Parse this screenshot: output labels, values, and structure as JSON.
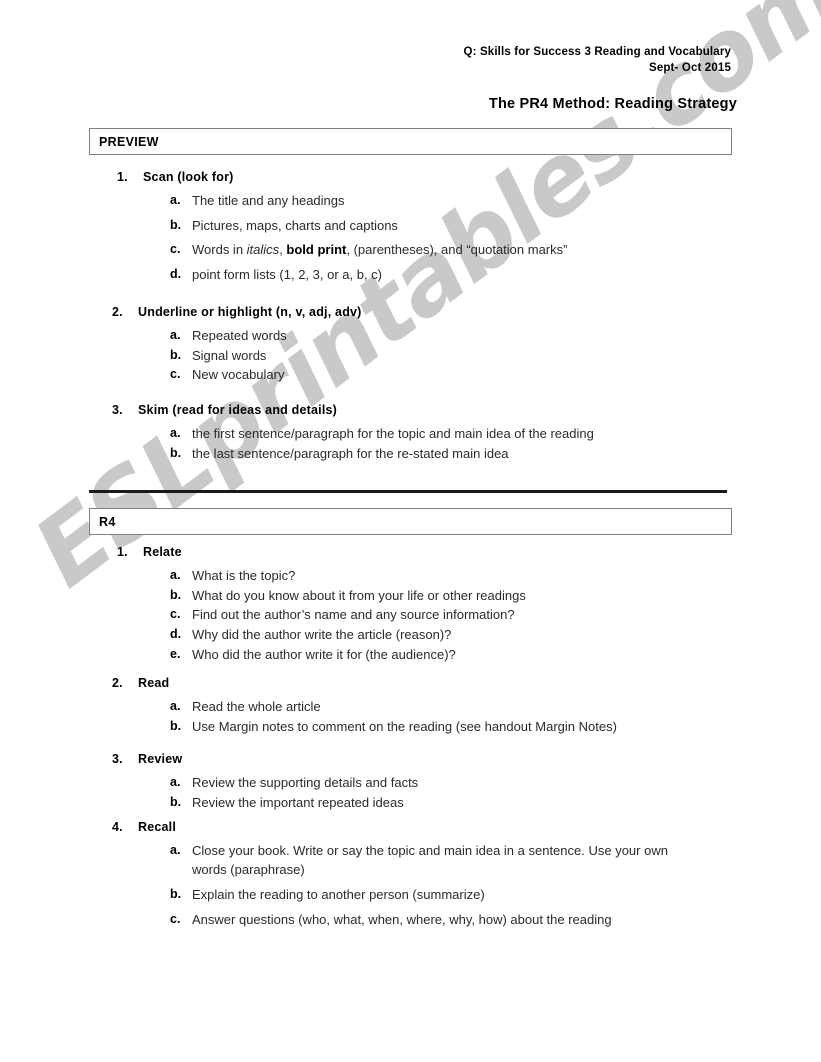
{
  "header": {
    "course": "Q: Skills for Success 3 Reading and Vocabulary",
    "date": "Sept- Oct 2015",
    "title": "The PR4 Method:  Reading Strategy"
  },
  "sections": [
    {
      "bar_label": "PREVIEW",
      "items": [
        {
          "number": "1.",
          "title": "Scan (look for)",
          "sub_items": [
            {
              "letter": "a.",
              "text": "The title and any headings"
            },
            {
              "letter": "b.",
              "text": "Pictures, maps, charts and captions"
            },
            {
              "letter": "c.",
              "text": "Words in italics, bold print, (parentheses), and “quotation marks”"
            },
            {
              "letter": "d.",
              "text": "point form lists (1, 2, 3, or a, b, c)"
            }
          ]
        },
        {
          "number": "2.",
          "title": "Underline or highlight (n, v, adj, adv)",
          "sub_items": [
            {
              "letter": "a.",
              "text": "Repeated words"
            },
            {
              "letter": "b.",
              "text": "Signal words"
            },
            {
              "letter": "c.",
              "text": "New vocabulary"
            }
          ]
        },
        {
          "number": "3.",
          "title": "Skim (read for ideas and details)",
          "sub_items": [
            {
              "letter": "a.",
              "text": "the first sentence/paragraph for the topic and main idea of the reading"
            },
            {
              "letter": "b.",
              "text": "the last sentence/paragraph for the re-stated main idea"
            }
          ]
        }
      ]
    },
    {
      "bar_label": "R4",
      "items": [
        {
          "number": "1.",
          "title": "Relate",
          "sub_items": [
            {
              "letter": "a.",
              "text": "What is the topic?"
            },
            {
              "letter": "b.",
              "text": "What do you know about it from your life or other readings"
            },
            {
              "letter": "c.",
              "text": "Find out the author’s name and any source information?"
            },
            {
              "letter": "d.",
              "text": "Why did the author write the article (reason)?"
            },
            {
              "letter": "e.",
              "text": "Who did the author write it for (the audience)?"
            }
          ]
        },
        {
          "number": "2.",
          "title": "Read",
          "sub_items": [
            {
              "letter": "a.",
              "text": "Read the whole article"
            },
            {
              "letter": "b.",
              "text": "Use Margin notes to comment on the reading (see handout Margin Notes)"
            }
          ]
        },
        {
          "number": "3.",
          "title": "Review",
          "sub_items": [
            {
              "letter": "a.",
              "text": "Review the supporting details and facts"
            },
            {
              "letter": "b.",
              "text": "Review the important repeated ideas"
            }
          ]
        },
        {
          "number": "4.",
          "title": "Recall",
          "sub_items": [
            {
              "letter": "a.",
              "text": "Close your book. Write or say the topic and main idea in a sentence. Use your own words (paraphrase)"
            },
            {
              "letter": "b.",
              "text": "Explain the reading to another person (summarize)"
            },
            {
              "letter": "c.",
              "text": "Answer questions (who, what, when, where, why, how) about the reading"
            }
          ]
        }
      ]
    }
  ],
  "watermark": {
    "text": "ESLprintables.com",
    "color": "#c9c9c9"
  }
}
